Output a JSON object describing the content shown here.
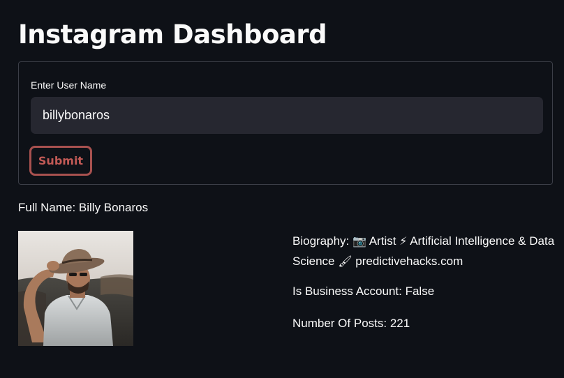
{
  "page": {
    "title": "Instagram Dashboard"
  },
  "form": {
    "label": "Enter User Name",
    "username_value": "billybonaros",
    "submit_label": "Submit"
  },
  "profile": {
    "full_name": "Full Name: Billy Bonaros",
    "biography_prefix": "Biography: ",
    "bio_parts": [
      "Artist",
      "Artificial Intelligence & Data Science",
      "predictivehacks.com"
    ],
    "bio_icons": [
      "camera-icon",
      "lightning-icon",
      "brush-icon"
    ],
    "is_business": "Is Business Account: False",
    "number_of_posts": "Number Of Posts: 221"
  },
  "colors": {
    "background": "#0e1117",
    "input_bg": "#262730",
    "submit_accent": "#c25a56",
    "border": "#3b3e47"
  }
}
